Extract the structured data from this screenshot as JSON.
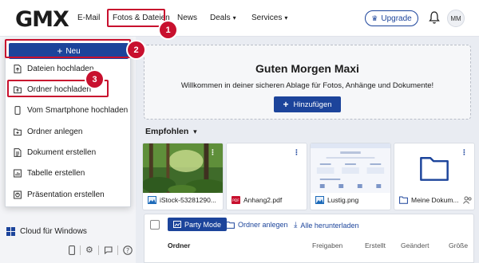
{
  "header": {
    "logo": "GMX",
    "nav": [
      {
        "label": "E-Mail",
        "dropdown": false
      },
      {
        "label": "Fotos & Dateien",
        "dropdown": false
      },
      {
        "label": "News",
        "dropdown": false
      },
      {
        "label": "Deals",
        "dropdown": true
      },
      {
        "label": "Services",
        "dropdown": true
      }
    ],
    "upgrade_label": "Upgrade",
    "avatar_initials": "MM"
  },
  "steps": [
    "1",
    "2",
    "3"
  ],
  "new_menu": {
    "button_label": "Neu",
    "items": [
      {
        "label": "Dateien hochladen",
        "icon": "file-upload-icon"
      },
      {
        "label": "Ordner hochladen",
        "icon": "folder-upload-icon"
      },
      {
        "label": "Vom Smartphone hochladen",
        "icon": "smartphone-icon"
      },
      {
        "label": "Ordner anlegen",
        "icon": "folder-add-icon"
      },
      {
        "label": "Dokument erstellen",
        "icon": "document-icon"
      },
      {
        "label": "Tabelle erstellen",
        "icon": "spreadsheet-icon"
      },
      {
        "label": "Präsentation erstellen",
        "icon": "presentation-icon"
      }
    ]
  },
  "sidebar": {
    "cloud_label": "Cloud für Windows"
  },
  "banner": {
    "title": "Guten Morgen Maxi",
    "subtitle": "Willkommen in deiner sicheren Ablage für Fotos, Anhänge und Dokumente!",
    "add_label": "Hinzufügen"
  },
  "recommended": {
    "label": "Empfohlen",
    "cards": [
      {
        "name": "iStock-53281290...",
        "icon": "image-icon"
      },
      {
        "name": "Anhang2.pdf",
        "icon": "pdf-icon"
      },
      {
        "name": "Lustig.png",
        "icon": "image-icon"
      },
      {
        "name": "Meine Dokum...",
        "icon": "folder-icon"
      }
    ]
  },
  "file_list": {
    "party_label": "Party Mode",
    "new_folder_label": "Ordner anlegen",
    "download_all_label": "Alle herunterladen",
    "columns": [
      "Ordner",
      "Freigaben",
      "Erstellt",
      "Geändert",
      "Größe"
    ]
  },
  "colors": {
    "brand_blue": "#1c449b",
    "highlight_red": "#c8102e"
  }
}
